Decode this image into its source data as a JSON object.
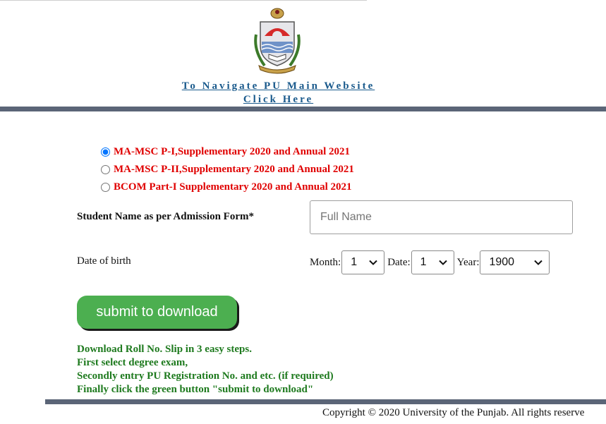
{
  "header": {
    "logo_icon": "university-of-the-punjab-crest-icon",
    "nav_line1": "To Navigate PU Main Website",
    "nav_line2": "Click Here"
  },
  "exams": [
    {
      "label": "MA-MSC P-I,Supplementary 2020 and Annual 2021",
      "selected": true
    },
    {
      "label": "MA-MSC P-II,Supplementary 2020 and Annual 2021",
      "selected": false
    },
    {
      "label": "BCOM Part-I Supplementary 2020 and Annual 2021",
      "selected": false
    }
  ],
  "form": {
    "name_label": "Student Name as per Admission Form*",
    "name_placeholder": "Full Name",
    "name_value": "",
    "dob_label": "Date of birth",
    "month_label": "Month:",
    "month_value": "1",
    "date_label": "Date:",
    "date_value": "1",
    "year_label": "Year:",
    "year_value": "1900",
    "submit_label": "submit to download"
  },
  "instructions": {
    "line1": "Download Roll No. Slip in 3 easy steps.",
    "line2": "First select degree exam,",
    "line3": "Secondly entry PU Registration No. and etc. (if required)",
    "line4": "Finally click the green button \"submit to download\""
  },
  "footer": {
    "copyright": "Copyright © 2020 University of the Punjab. All rights reserve"
  },
  "colors": {
    "exam_label": "#e00000",
    "submit_button": "#4caf50",
    "instructions": "#1e7a1e",
    "bars": "#5b6577",
    "link": "#1a5a8c"
  }
}
